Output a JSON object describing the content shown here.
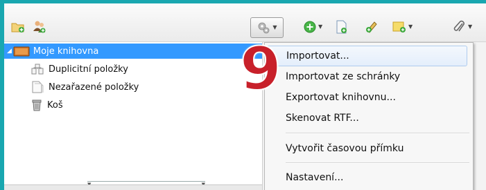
{
  "tree": {
    "items": [
      {
        "label": "Moje knihovna",
        "icon": "folder-library-icon",
        "selected": true
      },
      {
        "label": "Duplicitní položky",
        "icon": "duplicate-items-icon"
      },
      {
        "label": "Nezařazené položky",
        "icon": "unfiled-items-icon"
      },
      {
        "label": "Koš",
        "icon": "trash-icon"
      }
    ]
  },
  "menu": {
    "items": [
      {
        "label": "Importovat..."
      },
      {
        "label": "Importovat ze schránky"
      },
      {
        "label": "Exportovat knihovnu..."
      },
      {
        "label": "Skenovat RTF..."
      },
      {
        "label": "Vytvořit časovou přímku"
      },
      {
        "label": "Nastavení..."
      }
    ]
  },
  "annotation": {
    "step": "9"
  },
  "colors": {
    "selection": "#3399ff",
    "annotation": "#c8202a",
    "border_accent": "#19a7b0"
  }
}
